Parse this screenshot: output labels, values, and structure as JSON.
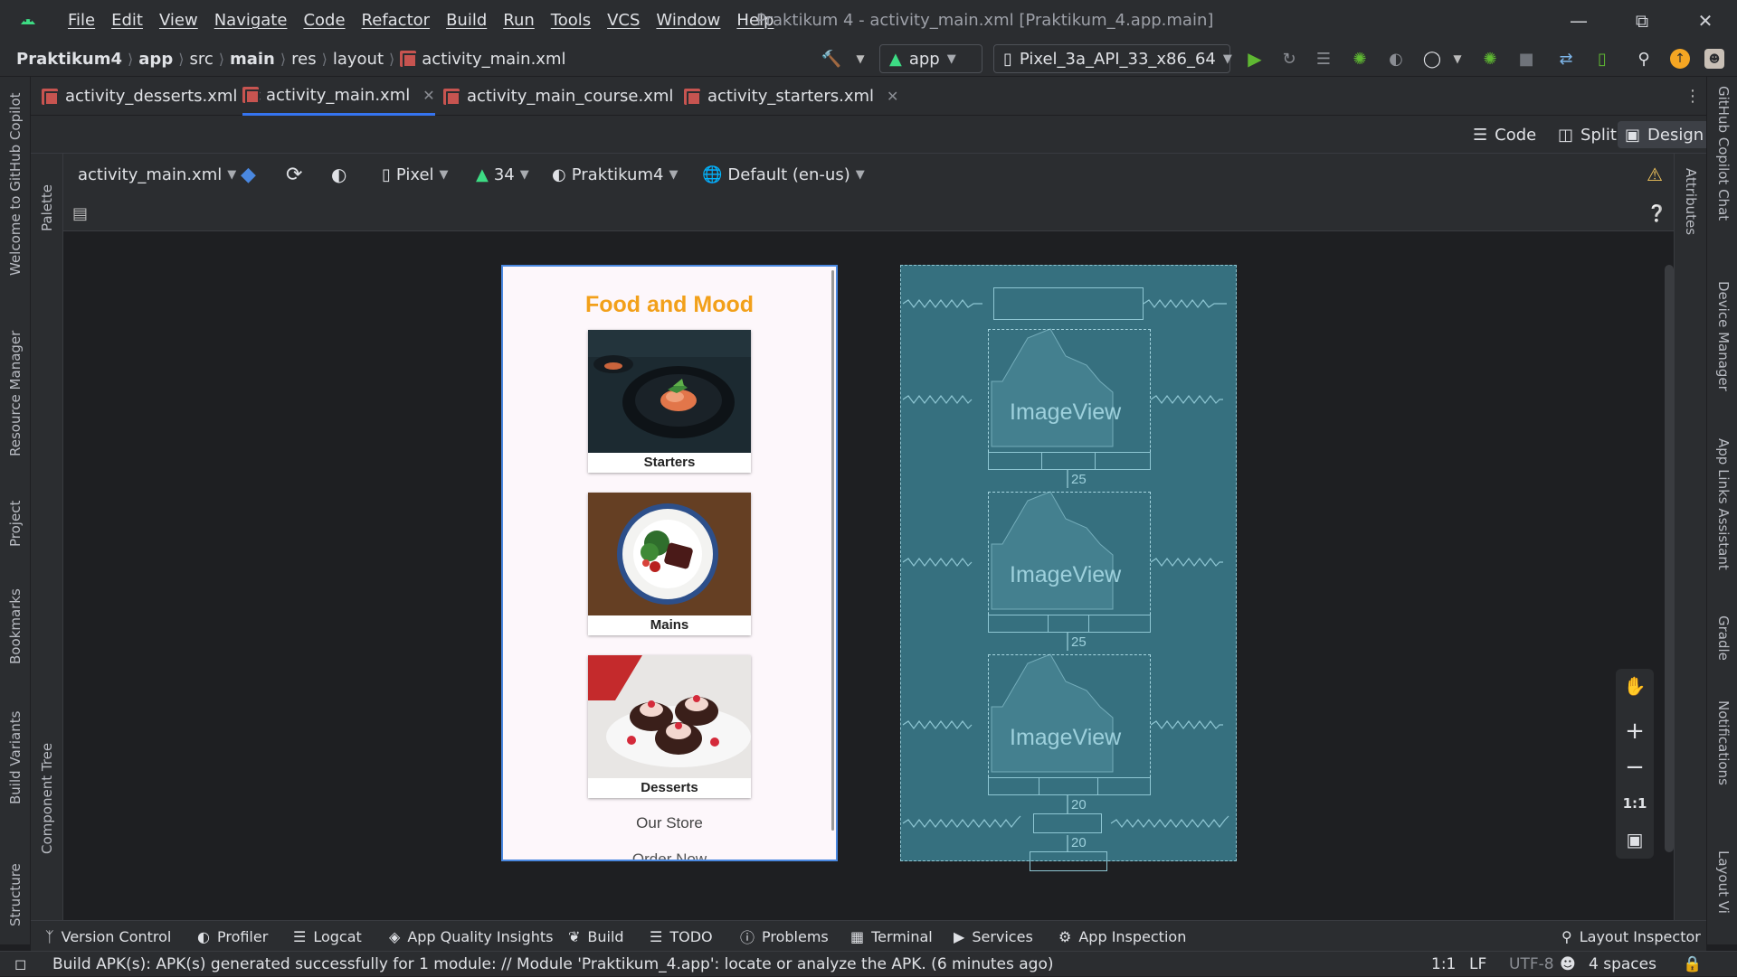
{
  "title_bar": {
    "menu": [
      "File",
      "Edit",
      "View",
      "Navigate",
      "Code",
      "Refactor",
      "Build",
      "Run",
      "Tools",
      "VCS",
      "Window",
      "Help"
    ],
    "window_title": "Praktikum 4 - activity_main.xml [Praktikum_4.app.main]"
  },
  "breadcrumb": [
    "Praktikum4",
    "app",
    "src",
    "main",
    "res",
    "layout",
    "activity_main.xml"
  ],
  "toolbar": {
    "run_config": "app",
    "device": "Pixel_3a_API_33_x86_64"
  },
  "tabs": [
    "activity_desserts.xml",
    "activity_main.xml",
    "activity_main_course.xml",
    "activity_starters.xml"
  ],
  "view_modes": [
    "Code",
    "Split",
    "Design"
  ],
  "design_toolbar": {
    "file": "activity_main.xml",
    "device": "Pixel",
    "api": "34",
    "theme": "Praktikum4",
    "locale": "Default (en-us)"
  },
  "left_tools": [
    "Welcome to GitHub Copilot",
    "Resource Manager",
    "Project",
    "Bookmarks",
    "Build Variants",
    "Structure"
  ],
  "inner_left_tools": [
    "Palette",
    "Component Tree"
  ],
  "right_tools": [
    "GitHub Copilot Chat",
    "Device Manager",
    "App Links Assistant",
    "Gradle",
    "Notifications",
    "Layout Vi"
  ],
  "inner_right_tools": [
    "Attributes"
  ],
  "preview": {
    "title": "Food and Mood",
    "cards": [
      "Starters",
      "Mains",
      "Desserts"
    ],
    "store": "Our Store",
    "order": "Order Now"
  },
  "blueprint": {
    "image_label": "ImageView",
    "margins": [
      "25",
      "25",
      "20",
      "20"
    ]
  },
  "zoom": {
    "actual": "1:1"
  },
  "bottom_tools": [
    "Version Control",
    "Profiler",
    "Logcat",
    "App Quality Insights",
    "Build",
    "TODO",
    "Problems",
    "Terminal",
    "Services",
    "App Inspection",
    "Layout Inspector"
  ],
  "status": {
    "message": "Build APK(s): APK(s) generated successfully for 1 module: // Module 'Praktikum_4.app': locate or analyze the APK. (6 minutes ago)",
    "position": "1:1",
    "line_ending": "LF",
    "encoding": "UTF-8",
    "indent": "4 spaces"
  },
  "colors": {
    "accent": "#3574f0",
    "title_orange": "#f2a01a",
    "blueprint": "#36707f",
    "run_green": "#5fb832"
  }
}
